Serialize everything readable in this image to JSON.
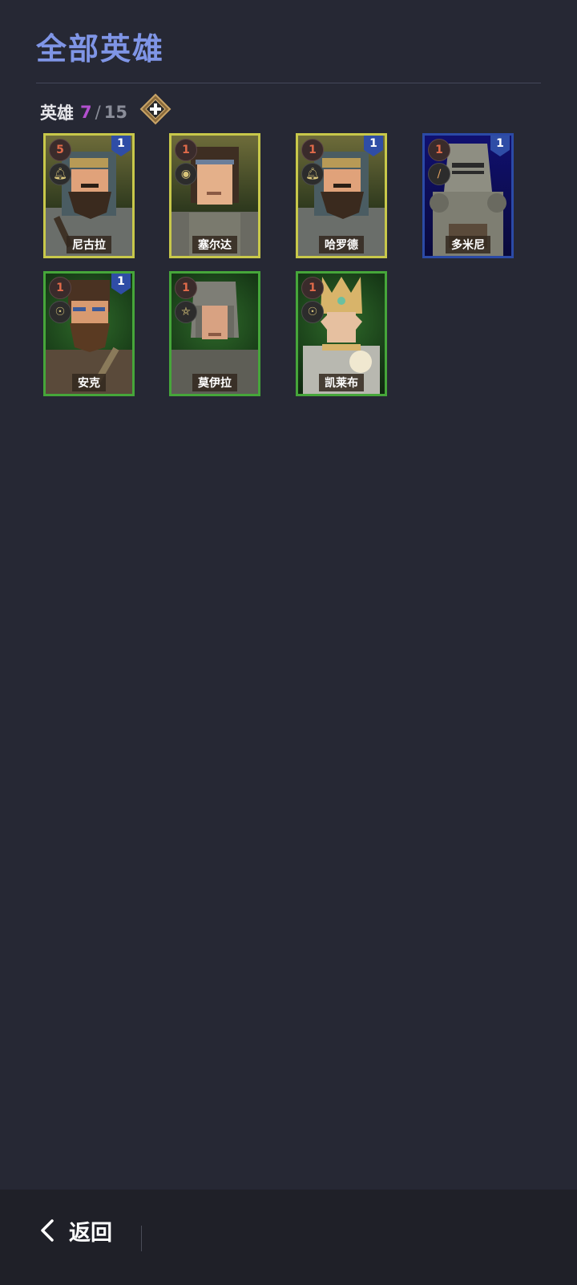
{
  "page": {
    "title": "全部英雄"
  },
  "hero_count": {
    "label": "英雄",
    "current": "7",
    "separator": "/",
    "max": "15"
  },
  "colors": {
    "rare_yellow": "#c8c84a",
    "epic_blue": "#2b4aa6",
    "common_green": "#46a63a",
    "accent_title": "#7f95e6",
    "count_purple": "#b34fcf"
  },
  "heroes": [
    {
      "name": "尼古拉",
      "stars": "5",
      "level": "1",
      "rarity": "yellow",
      "class_icon": "bell-icon"
    },
    {
      "name": "塞尔达",
      "stars": "1",
      "level": "",
      "rarity": "yellow",
      "class_icon": "eye-icon"
    },
    {
      "name": "哈罗德",
      "stars": "1",
      "level": "1",
      "rarity": "yellow",
      "class_icon": "bell-icon"
    },
    {
      "name": "多米尼",
      "stars": "1",
      "level": "1",
      "rarity": "blue",
      "class_icon": "sword-icon"
    },
    {
      "name": "安克",
      "stars": "1",
      "level": "1",
      "rarity": "green",
      "class_icon": "sun-icon"
    },
    {
      "name": "莫伊拉",
      "stars": "1",
      "level": "",
      "rarity": "green",
      "class_icon": "pentagram-icon"
    },
    {
      "name": "凯莱布",
      "stars": "1",
      "level": "",
      "rarity": "green",
      "class_icon": "sun-icon"
    }
  ],
  "footer": {
    "back_label": "返回"
  }
}
